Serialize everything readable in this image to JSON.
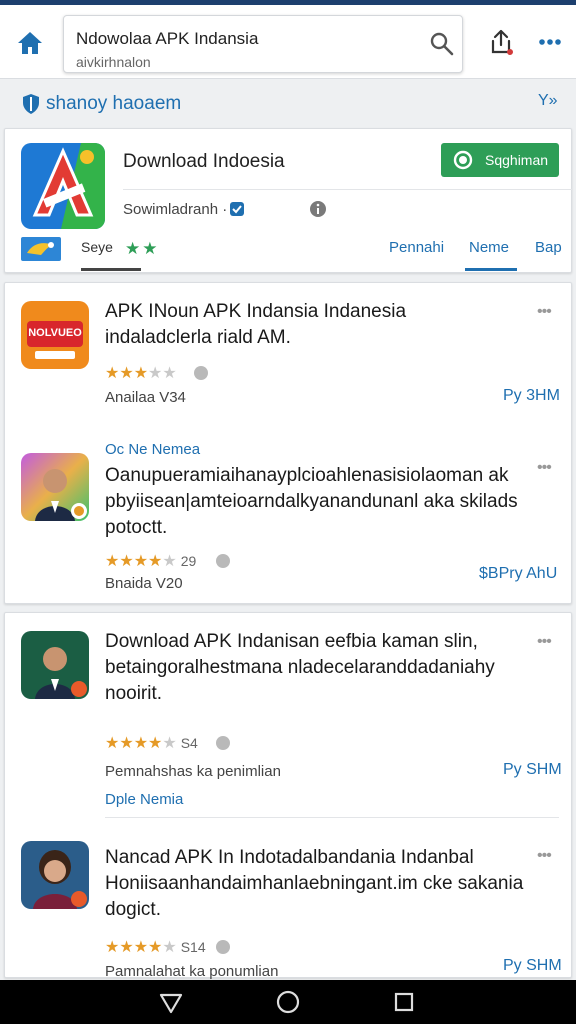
{
  "colors": {
    "accent": "#1f6fb0",
    "install": "#2e9e57",
    "star": "#e59a27",
    "topline": "#1d3f6e"
  },
  "topbar": {
    "search_title": "Ndowolaa APK Indansia",
    "search_sub": "aivkirhnalon",
    "icons": [
      "home-icon",
      "search-icon",
      "share-icon",
      "more-icon"
    ]
  },
  "crumb": {
    "label": "shanoy haoaem",
    "chevron": "Y»"
  },
  "app": {
    "title": "Download Indoesia",
    "install_label": "Sqghiman",
    "developer": "Sowimladranh ·",
    "save_label": "Seye",
    "tabs": [
      "Pennahi",
      "Neme",
      "Bap"
    ],
    "active_tab": "Neme"
  },
  "items": [
    {
      "kicker": "",
      "title_lines": [
        "APK INoun APK Indansia Indanesia",
        "indaladclerla riald AM."
      ],
      "rating": 3.5,
      "count": "",
      "meta": "Anailaa V34",
      "price": "Py 3HM",
      "link": "",
      "thumb_text": "NOLVUEO"
    },
    {
      "kicker": "Oc Ne Nemea",
      "title_lines": [
        "Oanupueramiaihanayplcioahlenasisiolaoman ak",
        "pbyiisean|amteioarndalkyanandunanl aka skilads",
        "potoctt."
      ],
      "rating": 4,
      "count": "29",
      "meta": "Bnaida V20",
      "price": "$BPry AhU",
      "link": ""
    },
    {
      "kicker": "",
      "title_lines": [
        "Download APK Indanisan eefbia kaman slin,",
        "betaingoralhestmana nladecelaranddadaniahy",
        "nooirit."
      ],
      "rating": 4,
      "count": "S4",
      "meta": "Pemnahshas ka penimlian",
      "price": "Py SHM",
      "link": "Dple Nemia"
    },
    {
      "kicker": "",
      "title_lines": [
        "Nancad APK In Indotadalbandania Indanbal",
        "Honiisaanhandaimhanlaebningant.im cke sakania",
        "dogict."
      ],
      "rating": 4,
      "count": "S14",
      "meta": "Pamnalahat ka ponumlian",
      "price": "Py SHM",
      "link": ""
    }
  ]
}
